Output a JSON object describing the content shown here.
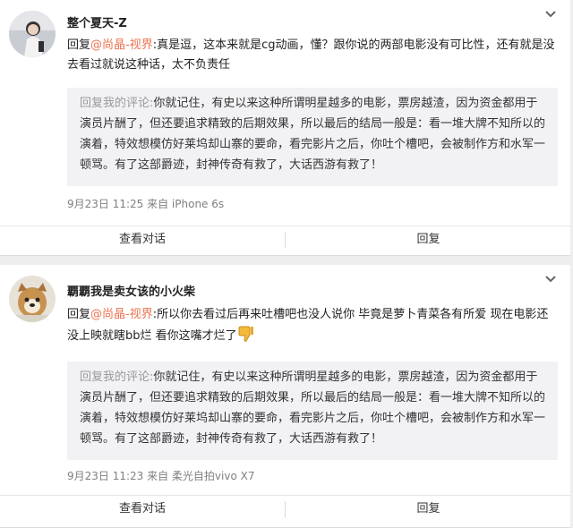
{
  "comments": [
    {
      "username": "整个夏天-Z",
      "reply_prefix": "回复",
      "mention": "@尚晶-视界",
      "reply_body": ":真是逗，这本来就是cg动画，懂？跟你说的两部电影没有可比性，还有就是没去看过就说这种话，太不负责任",
      "quote_prefix": "回复我的评论:",
      "quote_body": "你就记住，有史以来这种所谓明星越多的电影，票房越渣，因为资金都用于演员片酬了，但还要追求精致的后期效果，所以最后的结局一般是：看一堆大牌不知所以的演着，特效想模仿好莱坞却山寨的要命，看完影片之后，你吐个槽吧，会被制作方和水军一顿骂。有了这部爵迹，封神传奇有救了，大话西游有救了！",
      "meta": "9月23日  11:25 来自 iPhone 6s",
      "view_conversation": "查看对话",
      "reply_button": "回复"
    },
    {
      "username": "覇覇我是卖女该的小火柴",
      "reply_prefix": "回复",
      "mention": "@尚晶-视界",
      "reply_body": ":所以你去看过后再来吐槽吧也没人说你 毕竟是萝卜青菜各有所爱 现在电影还没上映就瞎bb烂 看你这嘴才烂了",
      "quote_prefix": "回复我的评论:",
      "quote_body": "你就记住，有史以来这种所谓明星越多的电影，票房越渣，因为资金都用于演员片酬了，但还要追求精致的后期效果，所以最后的结局一般是：看一堆大牌不知所以的演着，特效想模仿好莱坞却山寨的要命，看完影片之后，你吐个槽吧，会被制作方和水军一顿骂。有了这部爵迹，封神传奇有救了，大话西游有救了！",
      "meta": "9月23日  11:23 来自 柔光自拍vivo X7",
      "view_conversation": "查看对话",
      "reply_button": "回复"
    }
  ],
  "icons": {
    "more": "chevron-down-icon",
    "emoji": "thumbs-down-emoji"
  },
  "colors": {
    "mention": "#eb7350",
    "quote_bg": "#f2f2f5",
    "meta": "#808080"
  }
}
